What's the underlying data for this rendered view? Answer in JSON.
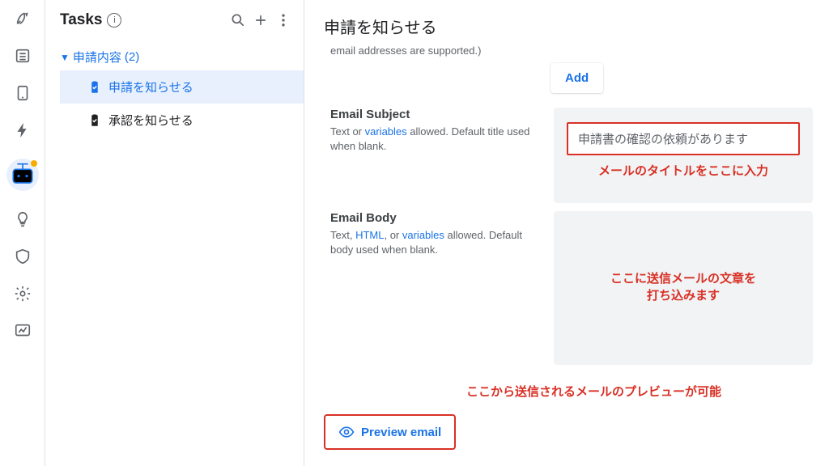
{
  "rail": {
    "items": [
      {
        "name": "rocket-icon"
      },
      {
        "name": "list-icon"
      },
      {
        "name": "tablet-icon"
      },
      {
        "name": "bolt-icon"
      },
      {
        "name": "bot-icon",
        "selected": true,
        "badge": true
      },
      {
        "name": "lightbulb-icon"
      },
      {
        "name": "shield-icon"
      },
      {
        "name": "gear-icon"
      },
      {
        "name": "chart-icon"
      }
    ]
  },
  "panel": {
    "title": "Tasks",
    "group": {
      "label": "申請内容",
      "count": "(2)"
    },
    "tasks": [
      {
        "label": "申請を知らせる",
        "active": true
      },
      {
        "label": "承認を知らせる",
        "active": false
      }
    ]
  },
  "main": {
    "title": "申請を知らせる",
    "hint_supported": "email addresses are supported.)",
    "add_label": "Add",
    "subject": {
      "title": "Email Subject",
      "desc_pre": "Text or ",
      "desc_link": "variables",
      "desc_post": " allowed. Default title used when blank.",
      "value": "申請書の確認の依頼があります",
      "annotation": "メールのタイトルをここに入力"
    },
    "body": {
      "title": "Email Body",
      "desc_pre": "Text, ",
      "desc_link1": "HTML",
      "desc_mid": ", or ",
      "desc_link2": "variables",
      "desc_post": " allowed. Default body used when blank.",
      "annotation_l1": "ここに送信メールの文章を",
      "annotation_l2": "打ち込みます"
    },
    "preview": {
      "annotation": "ここから送信されるメールのプレビューが可能",
      "label": "Preview email"
    }
  }
}
